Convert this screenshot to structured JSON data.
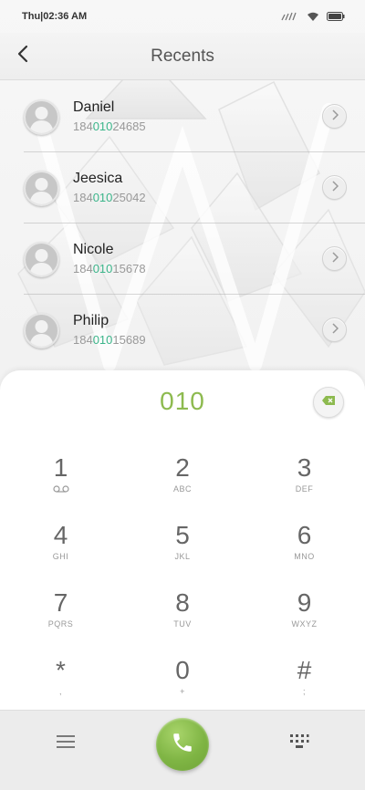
{
  "status_bar": {
    "time": "Thu|02:36 AM"
  },
  "header": {
    "title": "Recents"
  },
  "recents": [
    {
      "name": "Daniel",
      "number_prefix": "184",
      "number_match": "010",
      "number_suffix": "24685"
    },
    {
      "name": "Jeesica",
      "number_prefix": "184",
      "number_match": "010",
      "number_suffix": "25042"
    },
    {
      "name": "Nicole",
      "number_prefix": "184",
      "number_match": "010",
      "number_suffix": "15678"
    },
    {
      "name": "Philip",
      "number_prefix": "184",
      "number_match": "010",
      "number_suffix": "15689"
    }
  ],
  "dialpad": {
    "display": "010",
    "keys": [
      {
        "digit": "1",
        "letters": ""
      },
      {
        "digit": "2",
        "letters": "ABC"
      },
      {
        "digit": "3",
        "letters": "DEF"
      },
      {
        "digit": "4",
        "letters": "GHI"
      },
      {
        "digit": "5",
        "letters": "JKL"
      },
      {
        "digit": "6",
        "letters": "MNO"
      },
      {
        "digit": "7",
        "letters": "PQRS"
      },
      {
        "digit": "8",
        "letters": "TUV"
      },
      {
        "digit": "9",
        "letters": "WXYZ"
      },
      {
        "digit": "*",
        "letters": ","
      },
      {
        "digit": "0",
        "letters": "+"
      },
      {
        "digit": "#",
        "letters": ";"
      }
    ]
  },
  "icons": {
    "back": "chevron-left-icon",
    "detail": "chevron-right-icon",
    "backspace": "backspace-icon",
    "voicemail": "voicemail-icon",
    "menu": "menu-icon",
    "call": "phone-icon",
    "keypad": "dialpad-icon"
  },
  "colors": {
    "accent_green": "#8dba4f",
    "match_green": "#3bb58a",
    "call_green": "#7fb544"
  }
}
